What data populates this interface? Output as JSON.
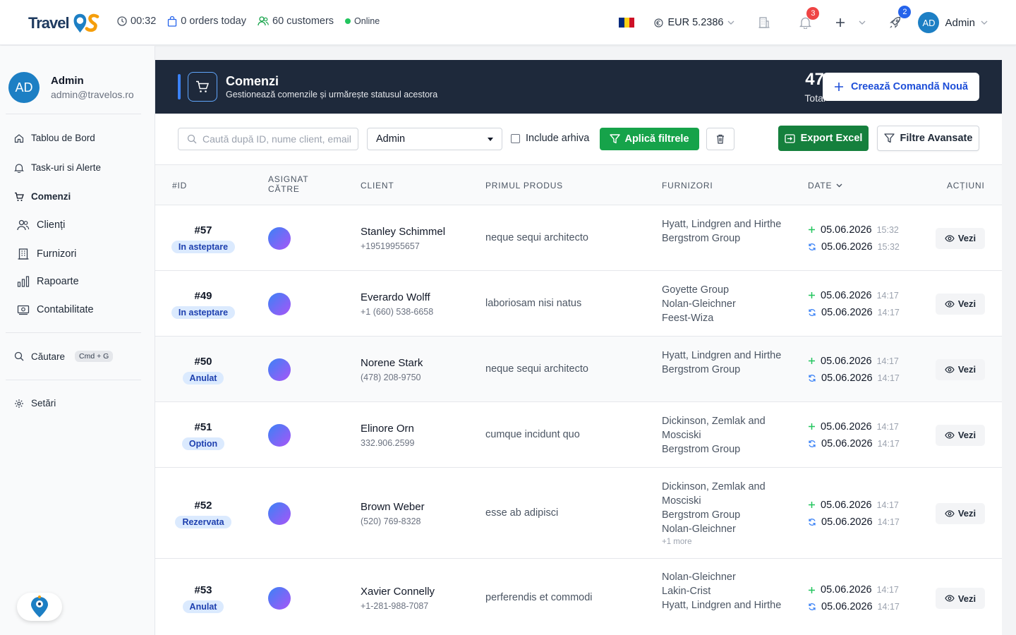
{
  "topbar": {
    "logo_text": "Travel",
    "timer": "00:32",
    "orders_today": "0 orders today",
    "customers": "60 customers",
    "status": "Online",
    "currency": "EUR 5.2386",
    "notifications_count": "3",
    "rocket_count": "2",
    "user_initials": "AD",
    "user_name": "Admin"
  },
  "sidebar": {
    "profile": {
      "initials": "AD",
      "name": "Admin",
      "email": "admin@travelos.ro"
    },
    "items": [
      {
        "label": "Tablou de Bord",
        "icon": "home-icon"
      },
      {
        "label": "Task-uri si Alerte",
        "icon": "bell-icon"
      },
      {
        "label": "Comenzi",
        "icon": "cart-icon"
      },
      {
        "label": "Clienți",
        "icon": "users-icon"
      },
      {
        "label": "Furnizori",
        "icon": "building-icon"
      },
      {
        "label": "Rapoarte",
        "icon": "chart-icon"
      },
      {
        "label": "Contabilitate",
        "icon": "money-icon"
      }
    ],
    "search_label": "Căutare",
    "search_shortcut": "Cmd + G",
    "settings_label": "Setări"
  },
  "header": {
    "title": "Comenzi",
    "subtitle": "Gestionează comenzile și urmărește statusul acestora",
    "total_count": "47",
    "total_label": "Total",
    "new_order_label": "Creează Comandă Nouă"
  },
  "filters": {
    "search_placeholder": "Caută după ID, nume client, email",
    "assignee_value": "Admin",
    "archive_label": "Include arhiva",
    "apply_label": "Aplică filtrele",
    "export_label": "Export Excel",
    "advanced_label": "Filtre Avansate"
  },
  "table": {
    "headers": {
      "id": "#ID",
      "assigned": "ASIGNAT CĂTRE",
      "client": "CLIENT",
      "product": "PRIMUL PRODUS",
      "suppliers": "FURNIZORI",
      "date": "DATE",
      "actions": "ACȚIUNI"
    },
    "view_label": "Vezi",
    "rows": [
      {
        "id": "#57",
        "status": "In asteptare",
        "client": "Stanley Schimmel",
        "phone": "+19519955657",
        "product": "neque sequi architecto",
        "suppliers": [
          "Hyatt, Lindgren and Hirthe",
          "Bergstrom Group"
        ],
        "more": "",
        "created_date": "05.06.2026",
        "created_time": "15:32",
        "updated_date": "05.06.2026",
        "updated_time": "15:32"
      },
      {
        "id": "#49",
        "status": "In asteptare",
        "client": "Everardo Wolff",
        "phone": "+1 (660) 538-6658",
        "product": "laboriosam nisi natus",
        "suppliers": [
          "Goyette Group",
          "Nolan-Gleichner",
          "Feest-Wiza"
        ],
        "more": "",
        "created_date": "05.06.2026",
        "created_time": "14:17",
        "updated_date": "05.06.2026",
        "updated_time": "14:17"
      },
      {
        "id": "#50",
        "status": "Anulat",
        "client": "Norene Stark",
        "phone": "(478) 208-9750",
        "product": "neque sequi architecto",
        "suppliers": [
          "Hyatt, Lindgren and Hirthe",
          "Bergstrom Group"
        ],
        "more": "",
        "created_date": "05.06.2026",
        "created_time": "14:17",
        "updated_date": "05.06.2026",
        "updated_time": "14:17"
      },
      {
        "id": "#51",
        "status": "Option",
        "client": "Elinore Orn",
        "phone": "332.906.2599",
        "product": "cumque incidunt quo",
        "suppliers": [
          "Dickinson, Zemlak and Mosciski",
          "Bergstrom Group"
        ],
        "more": "",
        "created_date": "05.06.2026",
        "created_time": "14:17",
        "updated_date": "05.06.2026",
        "updated_time": "14:17"
      },
      {
        "id": "#52",
        "status": "Rezervata",
        "client": "Brown Weber",
        "phone": "(520) 769-8328",
        "product": "esse ab adipisci",
        "suppliers": [
          "Dickinson, Zemlak and Mosciski",
          "Bergstrom Group",
          "Nolan-Gleichner"
        ],
        "more": "+1 more",
        "created_date": "05.06.2026",
        "created_time": "14:17",
        "updated_date": "05.06.2026",
        "updated_time": "14:17"
      },
      {
        "id": "#53",
        "status": "Anulat",
        "client": "Xavier Connelly",
        "phone": "+1-281-988-7087",
        "product": "perferendis et commodi",
        "suppliers": [
          "Nolan-Gleichner",
          "Lakin-Crist",
          "Hyatt, Lindgren and Hirthe"
        ],
        "more": "",
        "created_date": "05.06.2026",
        "created_time": "14:17",
        "updated_date": "05.06.2026",
        "updated_time": "14:17"
      }
    ]
  },
  "colors": {
    "accent_blue": "#1d4ed8",
    "header_dark": "#1e293b",
    "apply_green": "#16a34a",
    "excel_green": "#15803d",
    "status_bg": "#dbeafe",
    "online": "#22c55e",
    "badge_red": "#ef4444"
  }
}
